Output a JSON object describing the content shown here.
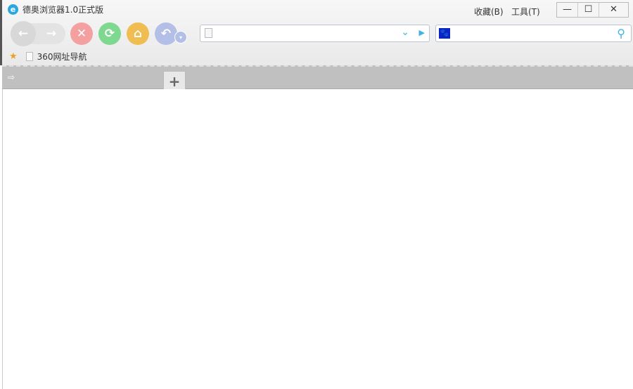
{
  "window": {
    "title": "德奥浏览器1.0正式版"
  },
  "menu": {
    "favorites": "收藏(B)",
    "tools": "工具(T)"
  },
  "window_controls": {
    "minimize": "—",
    "maximize": "☐",
    "close": "✕"
  },
  "nav": {
    "back": "←",
    "forward": "→",
    "stop": "✕",
    "refresh": "⟳",
    "home": "⌂",
    "undo": "↶"
  },
  "address": {
    "value": ""
  },
  "search": {
    "value": ""
  },
  "bookmarks": [
    {
      "label": "360网址导航"
    }
  ],
  "tabs": {
    "new_tab": "+"
  },
  "colors": {
    "stop": "#f4a0a0",
    "refresh": "#7ed88f",
    "home": "#f0bd52",
    "undo": "#b3bfe6"
  }
}
